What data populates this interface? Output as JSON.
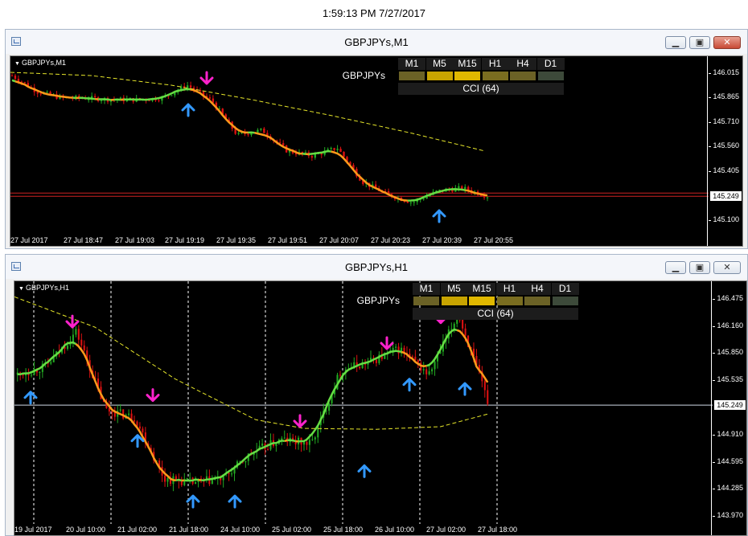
{
  "timestamp": "1:59:13 PM 7/27/2017",
  "colors": {
    "background": "#000000",
    "bull_candle": "#22aa22",
    "bear_candle": "#dd1111",
    "ma_fast": "#ff9a1a",
    "ma_trend": "#66dd44",
    "ma_slow": "#e6e62a",
    "up_arrow": "#3399ff",
    "down_arrow": "#ff22cc",
    "price_line": "#cc2222"
  },
  "icons": [
    "chart-window-icon",
    "minimize-icon",
    "restore-icon",
    "close-icon",
    "up-arrow-icon",
    "down-arrow-icon"
  ],
  "windows": [
    {
      "title": "GBPJPYs,M1",
      "symbol_label": "GBPJPYs,M1",
      "current_price": "145.249",
      "price_labels": [
        "146.015",
        "145.865",
        "145.710",
        "145.560",
        "145.405",
        "145.249",
        "145.100"
      ],
      "time_labels": [
        "27 Jul 2017",
        "27 Jul 18:47",
        "27 Jul 19:03",
        "27 Jul 19:19",
        "27 Jul 19:35",
        "27 Jul 19:51",
        "27 Jul 20:07",
        "27 Jul 20:23",
        "27 Jul 20:39",
        "27 Jul 20:55"
      ],
      "panel": {
        "timeframes": [
          "M1",
          "M5",
          "M15",
          "H1",
          "H4",
          "D1"
        ],
        "cell_colors": [
          "#6b6226",
          "#c8a400",
          "#e0b800",
          "#7a6d20",
          "#6b6226",
          "#3d4a3a"
        ],
        "symbol": "GBPJPYs",
        "indicator": "CCI (64)"
      },
      "chart_data": {
        "type": "candlestick",
        "series": [
          {
            "name": "close",
            "x": [
              "18:31",
              "18:39",
              "18:47",
              "18:55",
              "19:03",
              "19:11",
              "19:19",
              "19:23",
              "19:27",
              "19:35",
              "19:43",
              "19:51",
              "19:59",
              "20:07",
              "20:15",
              "20:23",
              "20:31",
              "20:39",
              "20:47",
              "20:55"
            ],
            "values": [
              146.0,
              145.9,
              145.86,
              145.86,
              145.85,
              145.85,
              145.86,
              145.94,
              145.84,
              145.63,
              145.66,
              145.53,
              145.5,
              145.55,
              145.34,
              145.26,
              145.21,
              145.28,
              145.3,
              145.25
            ]
          }
        ],
        "ylim": [
          145.05,
          146.05
        ],
        "grid": false,
        "markers": [
          {
            "type": "up",
            "x": "19:19",
            "value": 145.82
          },
          {
            "type": "down",
            "x": "19:23",
            "value": 145.95
          },
          {
            "type": "up",
            "x": "20:39",
            "value": 145.16
          }
        ]
      }
    },
    {
      "title": "GBPJPYs,H1",
      "symbol_label": "GBPJPYs,H1",
      "current_price": "145.249",
      "price_labels": [
        "146.475",
        "146.160",
        "145.850",
        "145.535",
        "145.249",
        "144.910",
        "144.595",
        "144.285",
        "143.970"
      ],
      "time_labels": [
        "19 Jul 2017",
        "20 Jul 10:00",
        "21 Jul 02:00",
        "21 Jul 18:00",
        "24 Jul 10:00",
        "25 Jul 02:00",
        "25 Jul 18:00",
        "26 Jul 10:00",
        "27 Jul 02:00",
        "27 Jul 18:00"
      ],
      "panel": {
        "timeframes": [
          "M1",
          "M5",
          "M15",
          "H1",
          "H4",
          "D1"
        ],
        "cell_colors": [
          "#6b6226",
          "#c8a400",
          "#e0b800",
          "#7a6d20",
          "#6b6226",
          "#3d4a3a"
        ],
        "symbol": "GBPJPYs",
        "indicator": "CCI (64)"
      },
      "chart_data": {
        "type": "candlestick",
        "series": [
          {
            "name": "close",
            "x": [
              "19 Jul",
              "20 Jul",
              "20 Jul 10",
              "21 Jul",
              "21 Jul 02",
              "21 Jul 18",
              "22 Jul",
              "24 Jul",
              "24 Jul 10",
              "25 Jul",
              "25 Jul 02",
              "25 Jul 18",
              "26 Jul",
              "26 Jul 10",
              "27 Jul",
              "27 Jul 02",
              "27 Jul 18"
            ],
            "values": [
              145.6,
              145.7,
              146.1,
              145.2,
              145.1,
              144.4,
              144.35,
              144.4,
              144.7,
              144.85,
              144.8,
              145.65,
              145.75,
              145.9,
              145.6,
              146.3,
              145.3
            ]
          }
        ],
        "ylim": [
          143.95,
          146.55
        ],
        "grid": true,
        "markers": [
          {
            "type": "up",
            "x": "19 Jul",
            "value": 145.4
          },
          {
            "type": "down",
            "x": "20 Jul 10",
            "value": 146.15
          },
          {
            "type": "up",
            "x": "21 Jul 02",
            "value": 144.9
          },
          {
            "type": "down",
            "x": "21 Jul 02",
            "value": 145.3
          },
          {
            "type": "up",
            "x": "21 Jul 18",
            "value": 144.2
          },
          {
            "type": "up",
            "x": "24 Jul 10",
            "value": 144.2
          },
          {
            "type": "down",
            "x": "25 Jul 02",
            "value": 145.0
          },
          {
            "type": "up",
            "x": "25 Jul 02",
            "value": 144.55
          },
          {
            "type": "down",
            "x": "26 Jul",
            "value": 145.9
          },
          {
            "type": "up",
            "x": "26 Jul 10",
            "value": 145.55
          },
          {
            "type": "down",
            "x": "26 Jul 10",
            "value": 146.2
          },
          {
            "type": "up",
            "x": "27 Jul",
            "value": 145.5
          }
        ]
      }
    }
  ]
}
